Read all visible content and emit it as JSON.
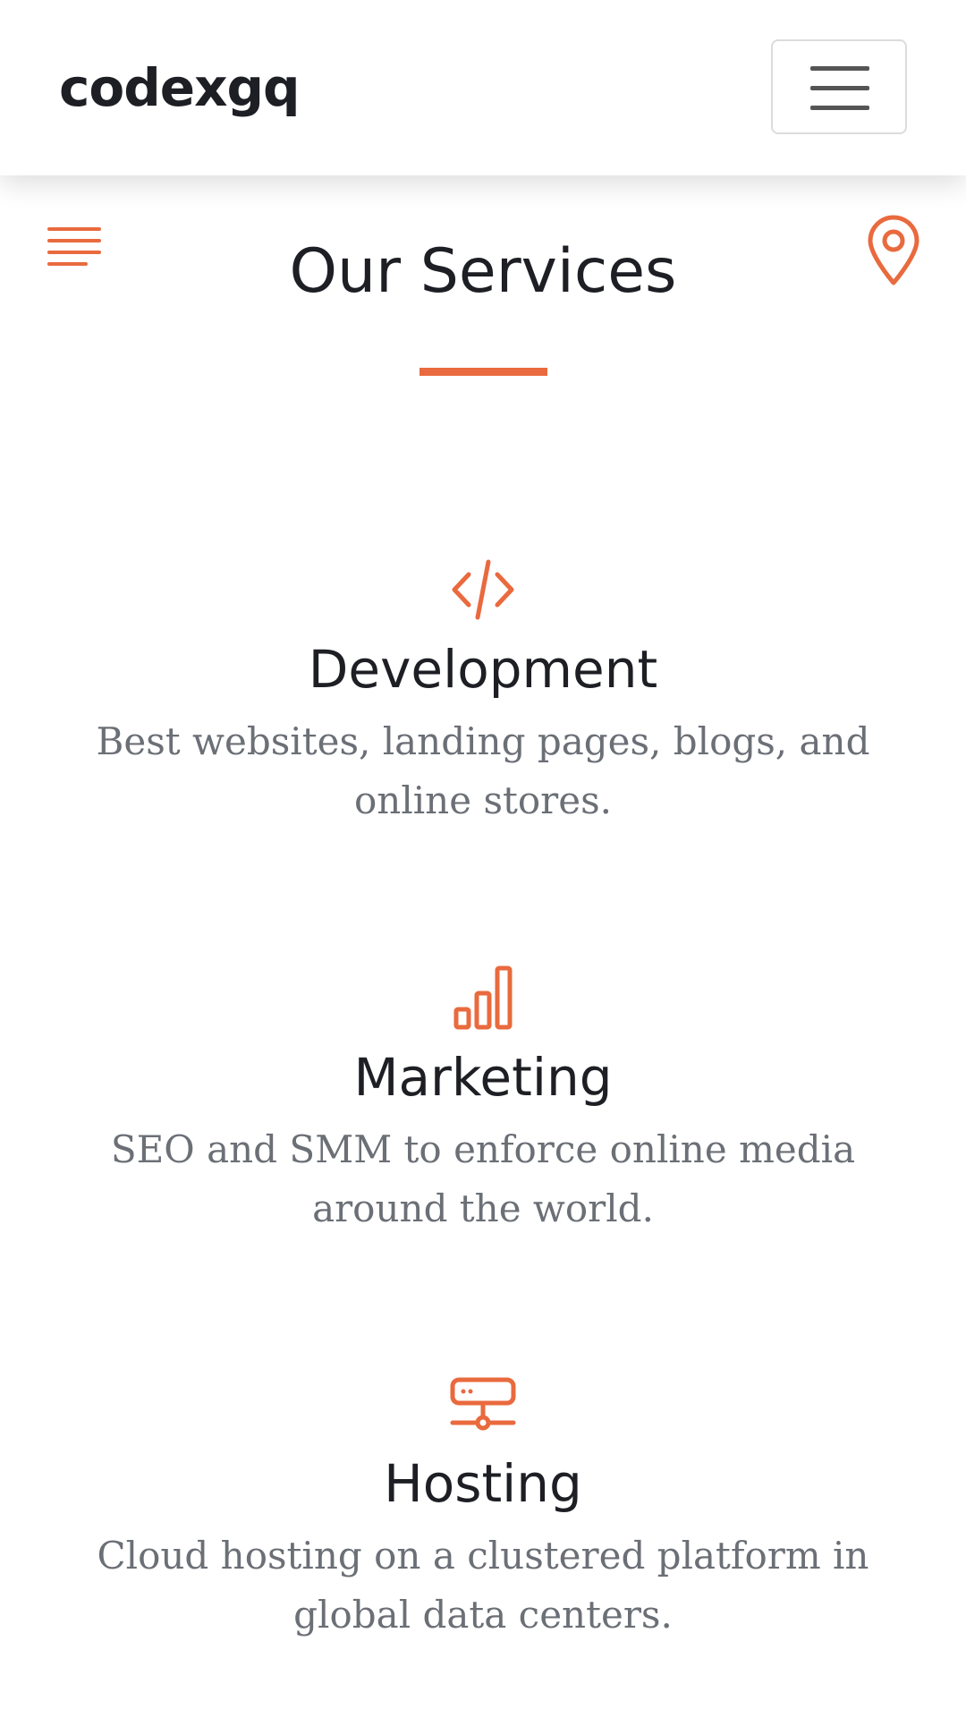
{
  "navbar": {
    "brand": "codexgq",
    "menu_toggle_icon": "hamburger-icon"
  },
  "page": {
    "left_icon": "text-lines-icon",
    "right_icon": "map-pin-icon",
    "title": "Our Services",
    "accent_color": "#e96a3e"
  },
  "services": [
    {
      "icon": "code-icon",
      "name": "Development",
      "description": "Best websites, landing pages, blogs, and online stores."
    },
    {
      "icon": "bar-chart-icon",
      "name": "Marketing",
      "description": "SEO and SMM to enforce online media around the world."
    },
    {
      "icon": "server-icon",
      "name": "Hosting",
      "description": "Cloud hosting on a clustered platform in global data centers."
    }
  ]
}
